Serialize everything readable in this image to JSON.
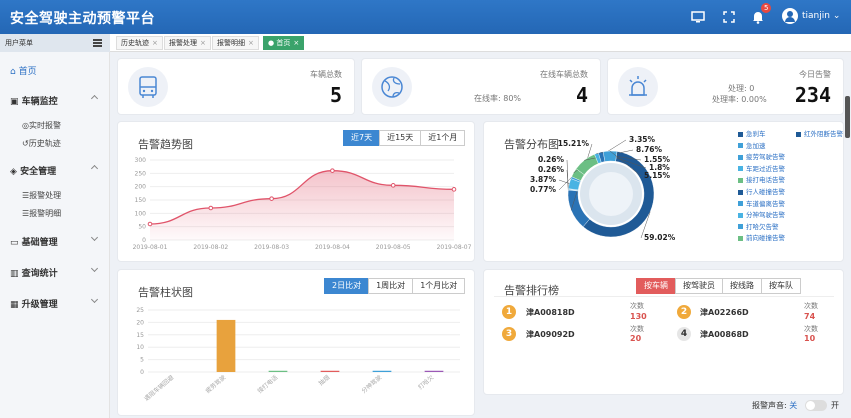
{
  "app": {
    "title": "安全驾驶主动预警平台",
    "username": "tianjin",
    "notification_count": "5"
  },
  "tabbar": {
    "menu_header": "用户菜单",
    "tabs": [
      {
        "label": "历史轨迹"
      },
      {
        "label": "报警处理"
      },
      {
        "label": "报警明细"
      },
      {
        "label": "首页"
      }
    ],
    "close_glyph": "×"
  },
  "sidebar": {
    "home": "首页",
    "vehicle_monitor": "车辆监控",
    "realtime_alarm": "实时报警",
    "history_track": "历史轨迹",
    "safety_mgmt": "安全管理",
    "alarm_handle": "报警处理",
    "alarm_detail": "报警明细",
    "basic_mgmt": "基础管理",
    "query_stats": "查询统计",
    "upgrade_mgmt": "升级管理"
  },
  "stats": {
    "vehicles": {
      "label": "车辆总数",
      "value": "5"
    },
    "online": {
      "label": "在线车辆总数",
      "value": "4",
      "rate_label": "在线率:",
      "rate": "80%"
    },
    "alarms": {
      "label": "今日告警",
      "value": "234",
      "handled_label": "处理:",
      "handled": "0",
      "handle_rate_label": "处理率:",
      "handle_rate": "0.00%"
    }
  },
  "trend": {
    "title": "告警趋势图",
    "buttons": [
      "近7天",
      "近15天",
      "近1个月"
    ]
  },
  "distribution": {
    "title": "告警分布图",
    "legend": [
      {
        "name": "急刹车",
        "color": "#1f5a96"
      },
      {
        "name": "红外阻断告警",
        "color": "#1f5a96"
      },
      {
        "name": "急加速",
        "color": "#3fa0d8"
      },
      {
        "name": "疲劳驾驶告警",
        "color": "#3fa0d8"
      },
      {
        "name": "车距过近告警",
        "color": "#49b3e3"
      },
      {
        "name": "接打电话告警",
        "color": "#6cbf84"
      },
      {
        "name": "行人碰撞告警",
        "color": "#1f5a96"
      },
      {
        "name": "车道偏离告警",
        "color": "#3fa0d8"
      },
      {
        "name": "分神驾驶告警",
        "color": "#49b3e3"
      },
      {
        "name": "打哈欠告警",
        "color": "#3fa0d8"
      },
      {
        "name": "前向碰撞告警",
        "color": "#6cbf84"
      }
    ]
  },
  "bar": {
    "title": "告警柱状图",
    "buttons": [
      "2日比对",
      "1周比对",
      "1个月比对"
    ]
  },
  "ranking": {
    "title": "告警排行榜",
    "buttons": [
      "按车辆",
      "按驾驶员",
      "按线路",
      "按车队"
    ],
    "count_label": "次数",
    "items": [
      {
        "rank": "1",
        "plate": "津A00818D",
        "count": "130"
      },
      {
        "rank": "2",
        "plate": "津A02266D",
        "count": "74"
      },
      {
        "rank": "3",
        "plate": "津A09092D",
        "count": "20"
      },
      {
        "rank": "4",
        "plate": "津A00868D",
        "count": "10"
      }
    ]
  },
  "footer": {
    "sound_label": "报警声音:",
    "off": "关",
    "on": "开"
  },
  "chart_data": [
    {
      "type": "area",
      "title": "告警趋势图",
      "x": [
        "2019-08-01",
        "2019-08-02",
        "2019-08-03",
        "2019-08-04",
        "2019-08-05",
        "2019-08-07"
      ],
      "y": [
        60,
        120,
        155,
        260,
        205,
        190
      ],
      "ylim": [
        0,
        300
      ],
      "yticks": [
        "0",
        "50",
        "100",
        "150",
        "200",
        "250",
        "300"
      ],
      "color": "#e0546a"
    },
    {
      "type": "pie",
      "title": "告警分布图",
      "labels": [
        "59.02%",
        "15.21%",
        "0.26%",
        "0.26%",
        "3.87%",
        "0.77%",
        "3.35%",
        "8.76%",
        "1.55%",
        "1.8%",
        "5.15%"
      ],
      "values": [
        59.02,
        15.21,
        0.26,
        0.26,
        3.87,
        0.77,
        3.35,
        8.76,
        1.55,
        1.8,
        5.15
      ],
      "colors": [
        "#1f5a96",
        "#2a73b5",
        "#3fa0d8",
        "#3fa0d8",
        "#49b3e3",
        "#3fa0d8",
        "#6cbf84",
        "#6cbf84",
        "#49b3e3",
        "#2a73b5",
        "#3fa0d8"
      ]
    },
    {
      "type": "bar",
      "title": "告警柱状图",
      "categories": [
        "遇阻车辆回避",
        "疲劳驾驶",
        "接打电话",
        "抽烟",
        "分神驾驶",
        "打哈欠"
      ],
      "values": [
        0,
        21,
        0.5,
        0.5,
        0.5,
        0.5
      ],
      "colors": [
        "#e8a23d",
        "#e8a23d",
        "#6cbf84",
        "#e25c5c",
        "#3fa0d8",
        "#9b59b6"
      ],
      "ylim": [
        0,
        25
      ],
      "yticks": [
        "0",
        "5",
        "10",
        "15",
        "20",
        "25"
      ]
    }
  ]
}
